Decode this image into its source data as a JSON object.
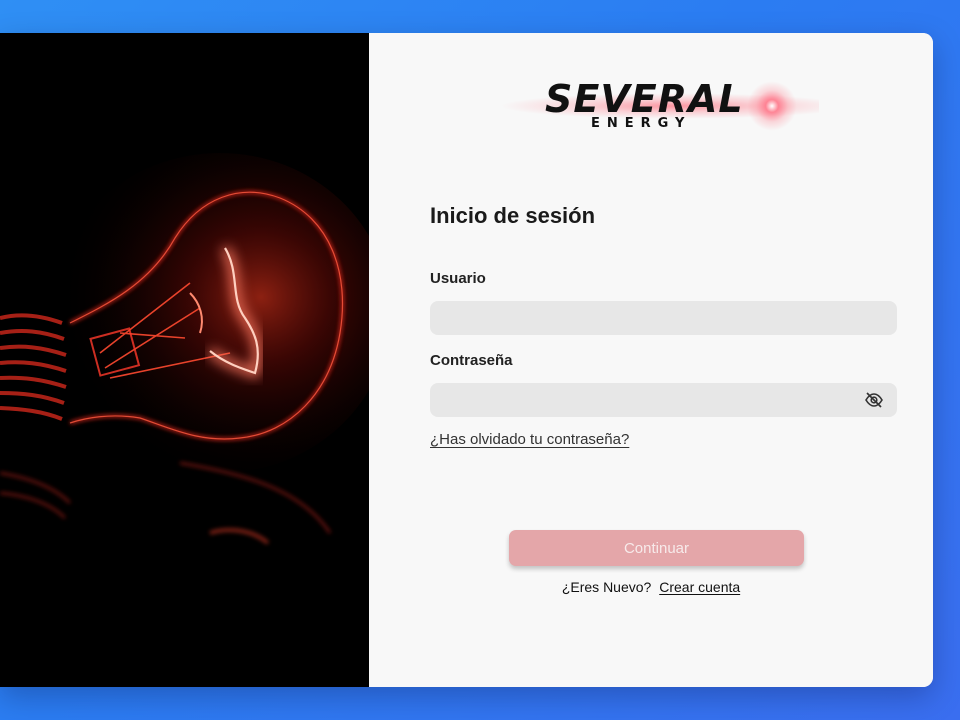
{
  "brand": {
    "name": "SEVERAL",
    "subtitle": "ENERGY"
  },
  "login": {
    "title": "Inicio de sesión",
    "username_label": "Usuario",
    "username_value": "",
    "username_placeholder": "",
    "password_label": "Contraseña",
    "password_value": "",
    "password_placeholder": "",
    "password_toggle_icon": "eye-off-icon",
    "forgot_link": "¿Has olvidado tu contraseña?",
    "submit_label": "Continuar",
    "new_user_prompt": "¿Eres Nuevo?",
    "create_account_link": "Crear cuenta"
  },
  "colors": {
    "background": "#2f8ff4",
    "submit_disabled": "#e4a6a9",
    "field_background": "#e7e7e7",
    "hero_glow": "#ff2a1a"
  }
}
